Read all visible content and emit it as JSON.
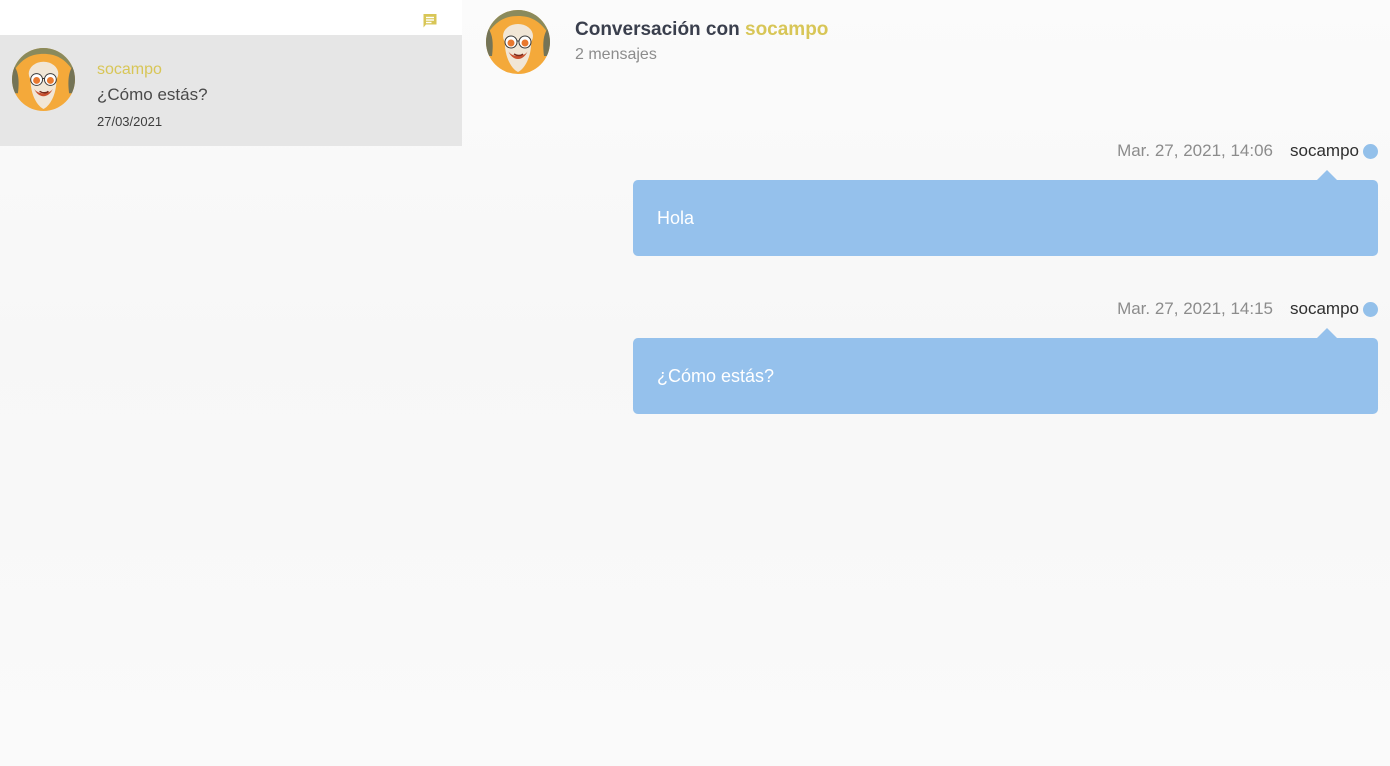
{
  "sidebar": {
    "conversations": [
      {
        "name": "socampo",
        "last_message": "¿Cómo estás?",
        "date": "27/03/2021"
      }
    ]
  },
  "header": {
    "title_prefix": "Conversación con",
    "user": "socampo",
    "message_count": "2 mensajes"
  },
  "messages": [
    {
      "time": "Mar. 27, 2021, 14:06",
      "author": "socampo",
      "text": "Hola"
    },
    {
      "time": "Mar. 27, 2021, 14:15",
      "author": "socampo",
      "text": "¿Cómo estás?"
    }
  ],
  "icons": {
    "new_message": "message-icon",
    "avatar": "user-avatar",
    "status": "online-dot-icon"
  },
  "colors": {
    "accent": "#d8c657",
    "bubble": "#95c1ec",
    "selected_item": "#e6e6e6",
    "title": "#3a3f4d",
    "muted": "#8c8c8c"
  }
}
